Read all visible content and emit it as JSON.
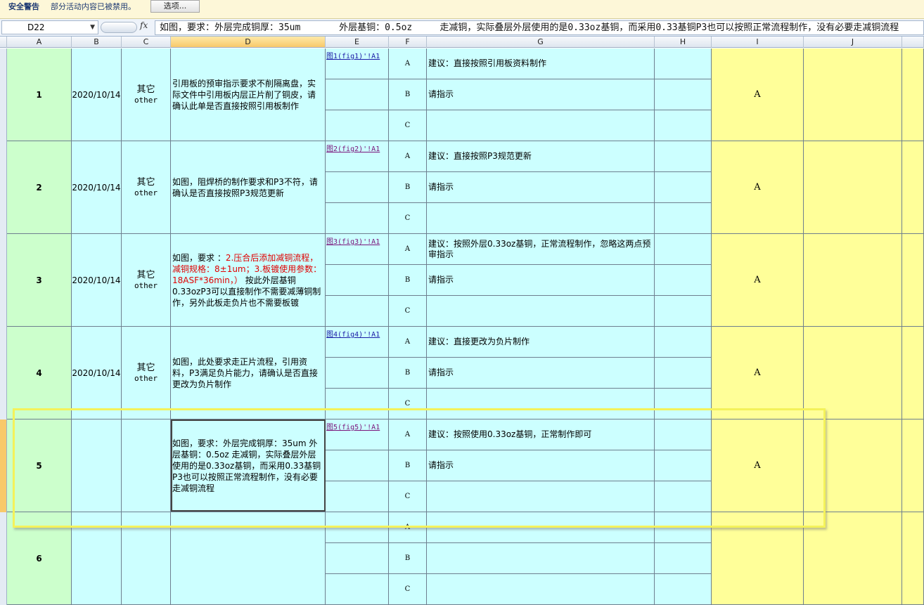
{
  "security_bar": {
    "title": "安全警告",
    "message": "部分活动内容已被禁用。",
    "options_button": "选项..."
  },
  "formula_bar": {
    "cell_ref": "D22",
    "fx": "fx",
    "content": "如图，要求：外层完成铜厚：35um       外层基铜：0.5oz     走减铜，实际叠层外层使用的是0.33oz基铜，而采用0.33基铜P3也可以按照正常流程制作，没有必要走减铜流程"
  },
  "columns": [
    "A",
    "B",
    "C",
    "D",
    "E",
    "F",
    "G",
    "H",
    "I",
    "J",
    ""
  ],
  "selected_column": "D",
  "colors": {
    "col_a": "#ccffcc",
    "cells": "#ccffff",
    "col_i": "#ffff99",
    "highlight": "#f4f25a"
  },
  "option_labels": [
    "A",
    "B",
    "C"
  ],
  "rows": [
    {
      "no": "1",
      "date": "2020/10/14",
      "cat_zh": "其它",
      "cat_en": "other",
      "desc_parts": [
        {
          "text": "引用板的预审指示要求不削隔离盘，实际文件中引用板内层正片削了铜皮，请确认此单是否直接按照引用板制作",
          "red": false
        }
      ],
      "link_prefix": "图",
      "link_rest": "1(fig1)'!A1",
      "visited": false,
      "sugg_a": "建议：直接按照引用板资料制作",
      "sugg_b": "请指示",
      "sugg_c": "",
      "answer": "A"
    },
    {
      "no": "2",
      "date": "2020/10/14",
      "cat_zh": "其它",
      "cat_en": "other",
      "desc_parts": [
        {
          "text": "如图，阻焊桥的制作要求和P3不符，请确认是否直接按照P3规范更新",
          "red": false
        }
      ],
      "link_prefix": "图",
      "link_rest": "2(fig2)'!A1",
      "visited": true,
      "sugg_a": "建议：直接按照P3规范更新",
      "sugg_b": "请指示",
      "sugg_c": "",
      "answer": "A"
    },
    {
      "no": "3",
      "date": "2020/10/14",
      "cat_zh": "其它",
      "cat_en": "other",
      "desc_parts": [
        {
          "text": "如图，要求 ：",
          "red": false
        },
        {
          "text": "2.压合后添加减铜流程，减铜规格：8±1um；",
          "red": true
        },
        {
          "text": "3.板镀使用参数：18ASF*36min，）",
          "red": true
        },
        {
          "text": "  按此外层基铜0.33ozP3可以直接制作不需要减薄铜制作，另外此板走负片也不需要板镀",
          "red": false
        }
      ],
      "link_prefix": "图",
      "link_rest": "3(fig3)'!A1",
      "visited": true,
      "sugg_a": "建议：按照外层0.33oz基铜，正常流程制作，忽略这两点预审指示",
      "sugg_b": "请指示",
      "sugg_c": "",
      "answer": "A"
    },
    {
      "no": "4",
      "date": "2020/10/14",
      "cat_zh": "其它",
      "cat_en": "other",
      "desc_parts": [
        {
          "text": "如图，此处要求走正片流程，引用资料，P3满足负片能力，请确认是否直接更改为负片制作",
          "red": false
        }
      ],
      "link_prefix": "图",
      "link_rest": "4(fig4)'!A1",
      "visited": false,
      "sugg_a": "建议：直接更改为负片制作",
      "sugg_b": "请指示",
      "sugg_c": "",
      "answer": "A"
    },
    {
      "no": "5",
      "date": "",
      "cat_zh": "",
      "cat_en": "",
      "desc_parts": [
        {
          "text": "如图，要求：外层完成铜厚：35um   外层基铜：0.5oz   走减铜，实际叠层外层使用的是0.33oz基铜，而采用0.33基铜P3也可以按照正常流程制作，没有必要走减铜流程",
          "red": false
        }
      ],
      "link_prefix": "图",
      "link_rest": "5(fig5)'!A1",
      "visited": true,
      "sugg_a": "建议：按照使用0.33oz基铜，正常制作即可",
      "sugg_b": "请指示",
      "sugg_c": "",
      "answer": "A"
    },
    {
      "no": "6",
      "date": "",
      "cat_zh": "",
      "cat_en": "",
      "desc_parts": [],
      "link_prefix": "",
      "link_rest": "",
      "visited": false,
      "sugg_a": "",
      "sugg_b": "",
      "sugg_c": "",
      "answer": ""
    }
  ]
}
